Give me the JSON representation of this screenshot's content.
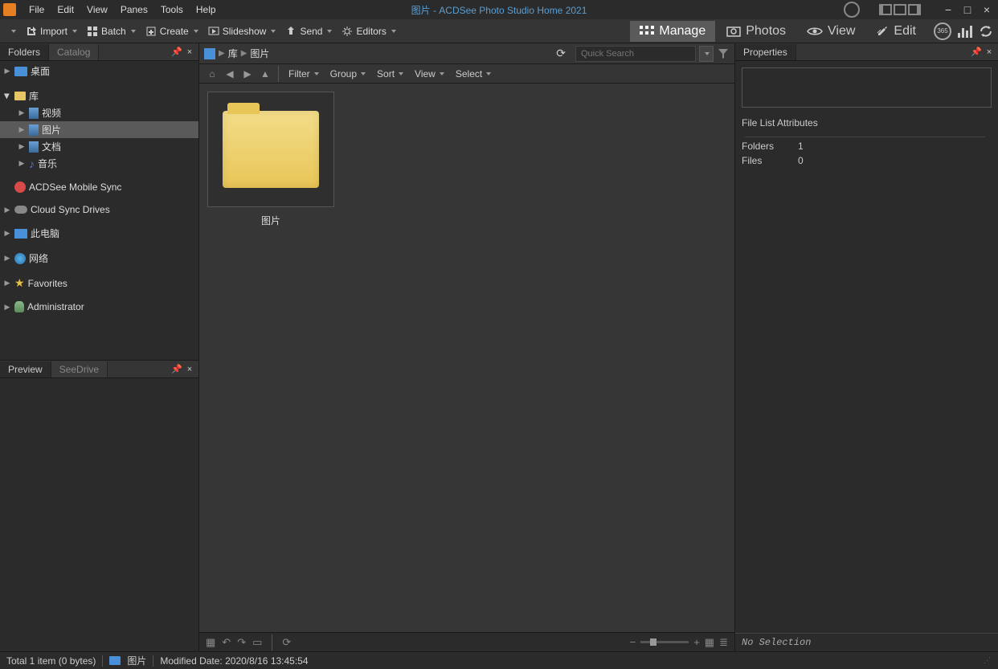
{
  "app_title": "图片 - ACDSee Photo Studio Home 2021",
  "menubar": [
    "File",
    "Edit",
    "View",
    "Panes",
    "Tools",
    "Help"
  ],
  "toolbar": {
    "import": "Import",
    "batch": "Batch",
    "create": "Create",
    "slideshow": "Slideshow",
    "send": "Send",
    "editors": "Editors"
  },
  "modes": {
    "manage": "Manage",
    "photos": "Photos",
    "view": "View",
    "edit": "Edit"
  },
  "panels": {
    "folders": "Folders",
    "catalog": "Catalog",
    "preview": "Preview",
    "seedrive": "SeeDrive",
    "properties": "Properties"
  },
  "tree": {
    "desktop": "桌面",
    "library": "库",
    "videos": "视频",
    "pictures": "图片",
    "documents": "文档",
    "music": "音乐",
    "mobile_sync": "ACDSee Mobile Sync",
    "cloud": "Cloud Sync Drives",
    "this_pc": "此电脑",
    "network": "网络",
    "favorites": "Favorites",
    "administrator": "Administrator"
  },
  "breadcrumb": {
    "lib": "库",
    "pictures": "图片"
  },
  "search_placeholder": "Quick Search",
  "filters": {
    "filter": "Filter",
    "group": "Group",
    "sort": "Sort",
    "view": "View",
    "select": "Select"
  },
  "thumb": {
    "name": "图片"
  },
  "properties": {
    "fla_header": "File List Attributes",
    "folders_label": "Folders",
    "folders_val": "1",
    "files_label": "Files",
    "files_val": "0",
    "no_selection": "No Selection"
  },
  "status": {
    "total": "Total 1 item  (0 bytes)",
    "sel_name": "图片",
    "modified": "Modified Date: 2020/8/16 13:45:54"
  }
}
